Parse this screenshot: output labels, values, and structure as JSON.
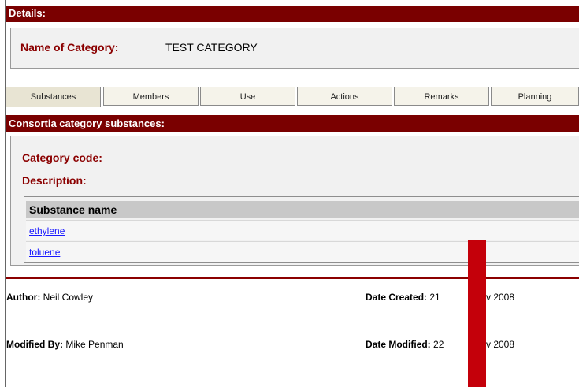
{
  "details": {
    "header": "Details:",
    "name_label": "Name of Category:",
    "name_value": "TEST CATEGORY"
  },
  "tabs": [
    {
      "label": "Substances",
      "active": true
    },
    {
      "label": "Members",
      "active": false
    },
    {
      "label": "Use",
      "active": false
    },
    {
      "label": "Actions",
      "active": false
    },
    {
      "label": "Remarks",
      "active": false
    },
    {
      "label": "Planning",
      "active": false
    }
  ],
  "consortia": {
    "header": "Consortia category substances:",
    "category_code_label": "Category code:",
    "description_label": "Description:",
    "table_header": "Substance name",
    "substances": [
      "ethylene",
      "toluene"
    ]
  },
  "footer": {
    "author_label": "Author:",
    "author_value": "Neil Cowley",
    "modified_by_label": "Modified By:",
    "modified_by_value": "Mike Penman",
    "date_created_label": "Date Created:",
    "date_created_value": "21 ",
    "date_created_tail": "v 2008",
    "date_modified_label": "Date Modified:",
    "date_modified_value": "22 ",
    "date_modified_tail": "v 2008"
  },
  "colors": {
    "header_bar": "#7a0000",
    "label_red": "#8b0000",
    "link_blue": "#1a1aff",
    "marker_red": "#c4000a"
  }
}
